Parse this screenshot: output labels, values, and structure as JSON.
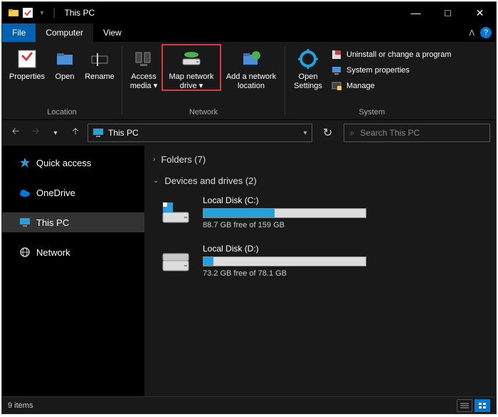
{
  "window": {
    "title": "This PC"
  },
  "titlebar_controls": {
    "min": "—",
    "max": "□",
    "close": "✕"
  },
  "ribbon": {
    "tabs": {
      "file": "File",
      "computer": "Computer",
      "view": "View"
    },
    "collapse": "ᐱ",
    "help": "?",
    "groups": {
      "location": {
        "label": "Location",
        "properties": "Properties",
        "open": "Open",
        "rename": "Rename"
      },
      "network": {
        "label": "Network",
        "access": "Access media ▾",
        "map": "Map network drive ▾",
        "addloc": "Add a network location"
      },
      "system": {
        "label": "System",
        "opensettings": "Open Settings",
        "uninstall": "Uninstall or change a program",
        "sysprops": "System properties",
        "manage": "Manage"
      }
    }
  },
  "nav": {
    "breadcrumb": "This PC",
    "dropdown": "▾",
    "search_placeholder": "Search This PC"
  },
  "sidebar": {
    "quick": "Quick access",
    "onedrive": "OneDrive",
    "thispc": "This PC",
    "network": "Network"
  },
  "content": {
    "folders_head": "Folders (7)",
    "drives_head": "Devices and drives (2)",
    "drives": [
      {
        "name": "Local Disk (C:)",
        "free": "88.7 GB free of 159 GB",
        "fill_pct": 44
      },
      {
        "name": "Local Disk (D:)",
        "free": "73.2 GB free of 78.1 GB",
        "fill_pct": 6
      }
    ]
  },
  "status": {
    "items": "9 items"
  }
}
